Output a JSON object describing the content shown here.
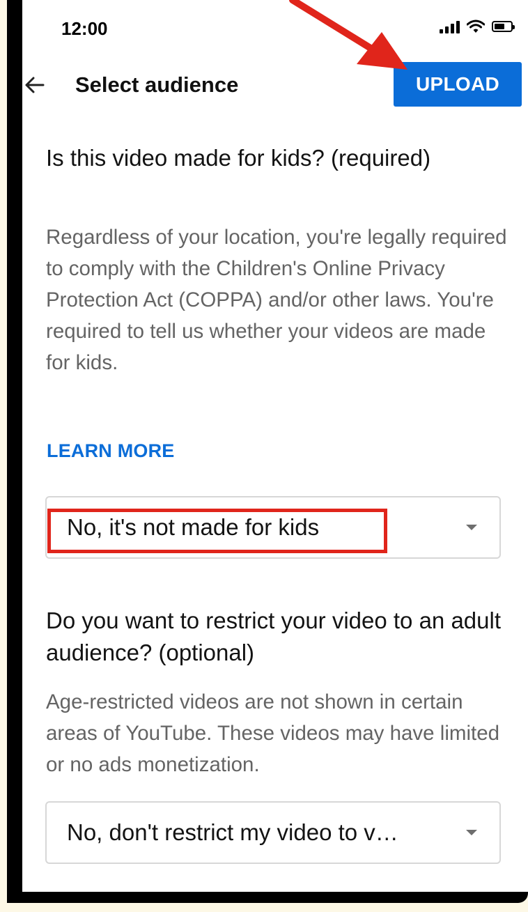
{
  "status_bar": {
    "time": "12:00"
  },
  "header": {
    "title": "Select audience",
    "upload_label": "UPLOAD"
  },
  "kids_section": {
    "title": "Is this video made for kids? (required)",
    "description": "Regardless of your location, you're legally required to comply with the Children's Online Privacy Protection Act (COPPA) and/or other laws. You're required to tell us whether your videos are made for kids.",
    "learn_more": "LEARN MORE",
    "selected_value": "No, it's not made for kids"
  },
  "age_section": {
    "title": "Do you want to restrict your video to an adult audience? (optional)",
    "description": "Age-restricted videos are not shown in certain areas of YouTube. These videos may have limited or no ads monetization.",
    "selected_value": "No, don't restrict my video to v…"
  },
  "colors": {
    "accent": "#0b6dd8",
    "annotation": "#e0251b"
  }
}
